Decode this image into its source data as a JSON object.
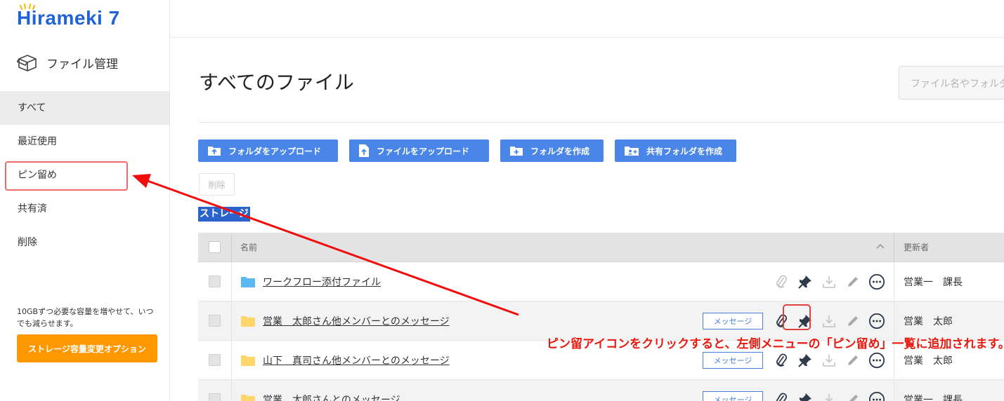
{
  "brand": {
    "logo_text": "Hirameki 7"
  },
  "sidebar": {
    "section_title": "ファイル管理",
    "items": [
      {
        "label": "すべて",
        "active": true
      },
      {
        "label": "最近使用"
      },
      {
        "label": "ピン留め"
      },
      {
        "label": "共有済"
      },
      {
        "label": "削除"
      }
    ],
    "storage_note": "10GBずつ必要な容量を増やせて、いつでも減らせます。",
    "storage_button": "ストレージ容量変更オプション"
  },
  "main": {
    "title": "すべてのファイル",
    "search_placeholder": "ファイル名やフォルダ名で検索",
    "toolbar": {
      "upload_folder": "フォルダをアップロード",
      "upload_file": "ファイルをアップロード",
      "create_folder": "フォルダを作成",
      "create_shared_folder": "共有フォルダを作成"
    },
    "delete_button": "削除",
    "breadcrumb": "ストレージ"
  },
  "table": {
    "headers": {
      "name": "名前",
      "updater": "更新者"
    },
    "rows": [
      {
        "name": "ワークフロー添付ファイル",
        "badge": "",
        "updater": "営業一　課長",
        "folder_color": "#5bb8f0"
      },
      {
        "name": "営業　太郎さん他メンバーとのメッセージ",
        "badge": "メッセージ",
        "updater": "営業　太郎",
        "folder_color": "#ffd66b"
      },
      {
        "name": "山下　真司さん他メンバーとのメッセージ",
        "badge": "メッセージ",
        "updater": "営業　太郎",
        "folder_color": "#ffd66b"
      },
      {
        "name": "営業　太郎さんとのメッセージ",
        "badge": "メッセージ",
        "updater": "営業一　課長",
        "folder_color": "#ffd66b"
      }
    ]
  },
  "annotation": "ピン留アイコンをクリックすると、左側メニューの「ピン留め」一覧に追加されます。",
  "colors": {
    "brand_blue": "#1f63d6",
    "button_blue": "#4a86e8",
    "orange": "#ff9800",
    "annotation_red": "#e8190e"
  }
}
